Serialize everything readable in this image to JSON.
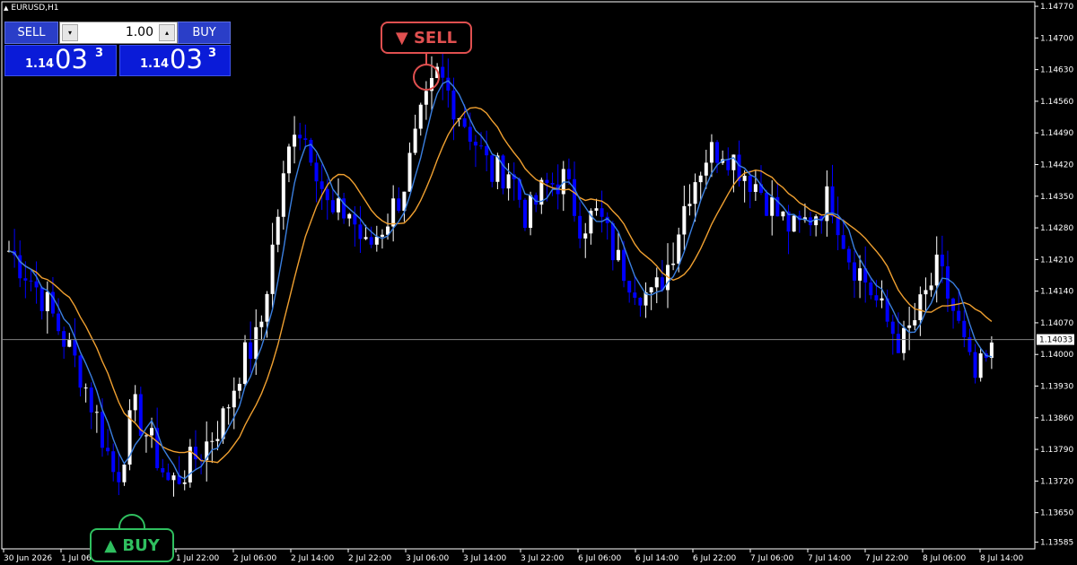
{
  "symbol": "EURUSD,H1",
  "trade_panel": {
    "sell_label": "SELL",
    "buy_label": "BUY",
    "lot_value": "1.00",
    "lot_down_icon": "▾",
    "lot_up_icon": "▴",
    "sell_price": {
      "small": "1.14",
      "big": "03",
      "sup": "3"
    },
    "buy_price": {
      "small": "1.14",
      "big": "03",
      "sup": "3"
    }
  },
  "signals": {
    "sell_label": "▼ SELL",
    "buy_label": "▲ BUY"
  },
  "colors": {
    "bull_candle": "#ffffff",
    "bear_candle": "#0000ff",
    "fast_ma": "#3a7fe0",
    "slow_ma": "#f0a030",
    "sell_signal": "#e05050",
    "buy_signal": "#2fbf5f",
    "current_price_line": "#808080"
  },
  "chart_data": {
    "type": "candlestick",
    "y_axis_ticks": [
      "1.14770",
      "1.14700",
      "1.14630",
      "1.14560",
      "1.14490",
      "1.14420",
      "1.14350",
      "1.14280",
      "1.14210",
      "1.14140",
      "1.14070",
      "1.14000",
      "1.13930",
      "1.13860",
      "1.13790",
      "1.13720",
      "1.13650",
      "1.13585"
    ],
    "x_axis_ticks": [
      "30 Jun 2026",
      "1 Jul 06:00",
      "1 Jul 14:00",
      "1 Jul 22:00",
      "2 Jul 06:00",
      "2 Jul 14:00",
      "2 Jul 22:00",
      "3 Jul 06:00",
      "3 Jul 14:00",
      "3 Jul 22:00",
      "6 Jul 06:00",
      "6 Jul 14:00",
      "6 Jul 22:00",
      "7 Jul 06:00",
      "7 Jul 14:00",
      "7 Jul 22:00",
      "8 Jul 06:00",
      "8 Jul 14:00"
    ],
    "current_price": "1.14033",
    "ylim": [
      1.1357,
      1.1478
    ],
    "close_path": [
      1.1423,
      1.1418,
      1.1412,
      1.1404,
      1.1396,
      1.1385,
      1.1372,
      1.1388,
      1.138,
      1.1371,
      1.1375,
      1.138,
      1.1386,
      1.1398,
      1.1404,
      1.143,
      1.1452,
      1.1445,
      1.143,
      1.1432,
      1.1423,
      1.1429,
      1.1436,
      1.1451,
      1.1462,
      1.1455,
      1.1448,
      1.144,
      1.1441,
      1.143,
      1.1437,
      1.1439,
      1.1429,
      1.1431,
      1.1421,
      1.1416,
      1.1412,
      1.1421,
      1.1436,
      1.1444,
      1.1446,
      1.1441,
      1.1437,
      1.1431,
      1.1427,
      1.1431,
      1.1435,
      1.1422,
      1.1416,
      1.1408,
      1.1402,
      1.141,
      1.1419,
      1.1408,
      1.1394,
      1.14
    ],
    "fast_ma_label": "",
    "slow_ma_label": ""
  }
}
